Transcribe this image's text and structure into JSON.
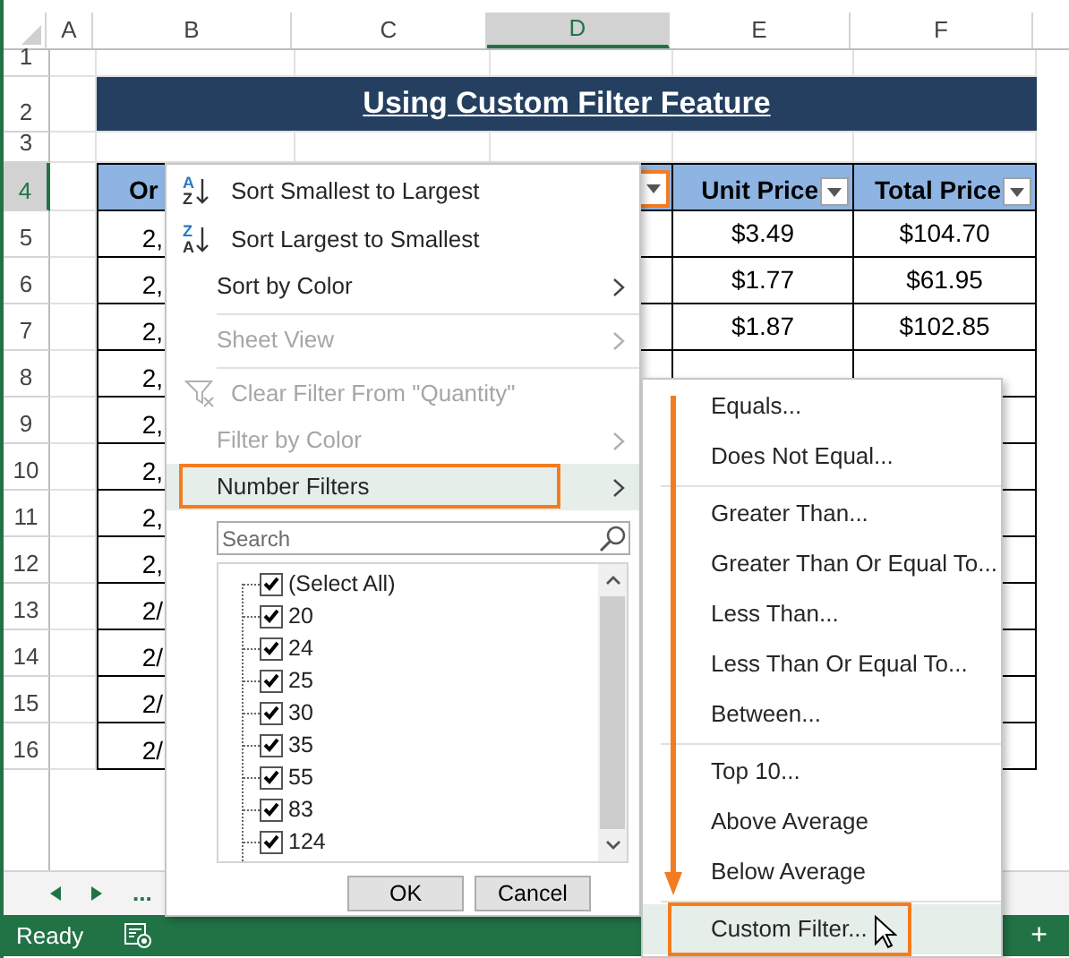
{
  "columns": [
    "A",
    "B",
    "C",
    "D",
    "E",
    "F"
  ],
  "row_numbers": [
    "1",
    "2",
    "3",
    "4",
    "5",
    "6",
    "7",
    "8",
    "9",
    "10",
    "11",
    "12",
    "13",
    "14",
    "15",
    "16"
  ],
  "title": "Using Custom Filter Feature",
  "header_cells": [
    {
      "kind": "text",
      "label": "Or"
    },
    {
      "kind": "blank"
    },
    {
      "kind": "filter",
      "highlighted": true
    },
    {
      "kind": "text_filter",
      "label": "Unit Price",
      "highlighted": false
    },
    {
      "kind": "text_filter",
      "label": "Total Price",
      "highlighted": false
    }
  ],
  "rows": [
    {
      "order": "2,",
      "unit_price": "$3.49",
      "total_price": "$104.70"
    },
    {
      "order": "2,",
      "unit_price": "$1.77",
      "total_price": "$61.95"
    },
    {
      "order": "2,",
      "unit_price": "$1.87",
      "total_price": "$102.85"
    },
    {
      "order": "2,"
    },
    {
      "order": "2,"
    },
    {
      "order": "2,"
    },
    {
      "order": "2,"
    },
    {
      "order": "2,"
    },
    {
      "order": "2/"
    },
    {
      "order": "2/"
    },
    {
      "order": "2/"
    },
    {
      "order": "2/"
    }
  ],
  "filter_menu": {
    "items": [
      {
        "kind": "sort",
        "label": "Sort Smallest to Largest",
        "icon_top": "A",
        "icon_bottom": "Z",
        "disabled": false,
        "submenu": false,
        "highlighted": false
      },
      {
        "kind": "sort",
        "label": "Sort Largest to Smallest",
        "icon_top": "Z",
        "icon_bottom": "A",
        "disabled": false,
        "submenu": false,
        "highlighted": false
      },
      {
        "kind": "item",
        "label": "Sort by Color",
        "disabled": false,
        "submenu": true,
        "highlighted": false
      },
      {
        "kind": "separator"
      },
      {
        "kind": "item",
        "label": "Sheet View",
        "disabled": true,
        "submenu": true,
        "highlighted": false
      },
      {
        "kind": "separator"
      },
      {
        "kind": "clear",
        "label": "Clear Filter From \"Quantity\"",
        "disabled": true,
        "submenu": false,
        "highlighted": false
      },
      {
        "kind": "item",
        "label": "Filter by Color",
        "disabled": true,
        "submenu": true,
        "highlighted": false
      },
      {
        "kind": "item",
        "label": "Number Filters",
        "disabled": false,
        "submenu": true,
        "highlighted": true
      }
    ],
    "search": {
      "placeholder": "Search"
    },
    "values": [
      {
        "label": "(Select All)",
        "checked": true
      },
      {
        "label": "20",
        "checked": true
      },
      {
        "label": "24",
        "checked": true
      },
      {
        "label": "25",
        "checked": true
      },
      {
        "label": "30",
        "checked": true
      },
      {
        "label": "35",
        "checked": true
      },
      {
        "label": "55",
        "checked": true
      },
      {
        "label": "83",
        "checked": true
      },
      {
        "label": "124",
        "checked": true
      }
    ],
    "buttons": [
      "OK",
      "Cancel"
    ]
  },
  "number_filters_menu": {
    "items": [
      {
        "kind": "item",
        "label": "Equals...",
        "highlighted": false
      },
      {
        "kind": "item",
        "label": "Does Not Equal...",
        "highlighted": false
      },
      {
        "kind": "separator"
      },
      {
        "kind": "item",
        "label": "Greater Than...",
        "highlighted": false
      },
      {
        "kind": "item",
        "label": "Greater Than Or Equal To...",
        "highlighted": false
      },
      {
        "kind": "item",
        "label": "Less Than...",
        "highlighted": false
      },
      {
        "kind": "item",
        "label": "Less Than Or Equal To...",
        "highlighted": false
      },
      {
        "kind": "item",
        "label": "Between...",
        "highlighted": false
      },
      {
        "kind": "separator"
      },
      {
        "kind": "item",
        "label": "Top 10...",
        "highlighted": false
      },
      {
        "kind": "item",
        "label": "Above Average",
        "highlighted": false
      },
      {
        "kind": "item",
        "label": "Below Average",
        "highlighted": false
      },
      {
        "kind": "separator"
      },
      {
        "kind": "item",
        "label": "Custom Filter...",
        "highlighted": true
      }
    ]
  },
  "sheet_nav": {
    "more": "..."
  },
  "status_bar": {
    "status": "Ready",
    "zoom_in": "+"
  }
}
